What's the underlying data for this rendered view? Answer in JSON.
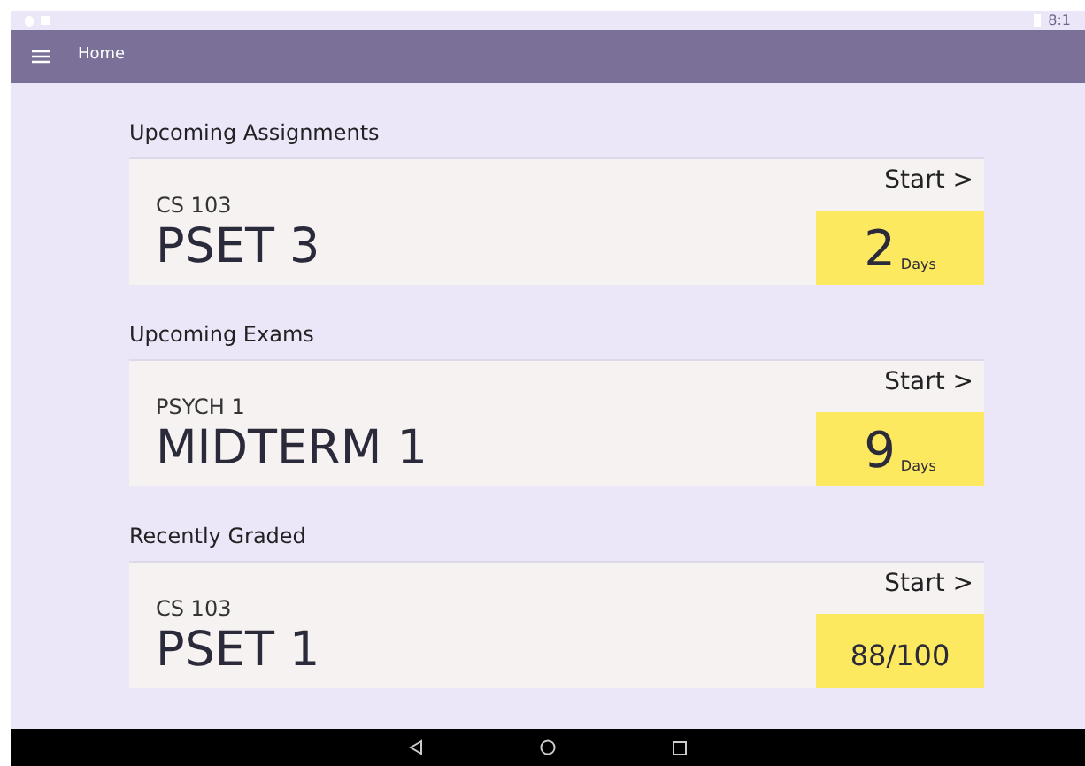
{
  "status_bar": {
    "time": "8:1"
  },
  "app_bar": {
    "title": "Home"
  },
  "sections": [
    {
      "heading": "Upcoming Assignments",
      "card": {
        "course": "CS 103",
        "title": "PSET 3",
        "action": "Start >",
        "value": "2",
        "unit": "Days"
      }
    },
    {
      "heading": "Upcoming Exams",
      "card": {
        "course": "PSYCH 1",
        "title": "MIDTERM 1",
        "action": "Start >",
        "value": "9",
        "unit": "Days"
      }
    },
    {
      "heading": "Recently Graded",
      "card": {
        "course": "CS 103",
        "title": "PSET 1",
        "action": "Start >",
        "value": "88/100"
      }
    }
  ]
}
